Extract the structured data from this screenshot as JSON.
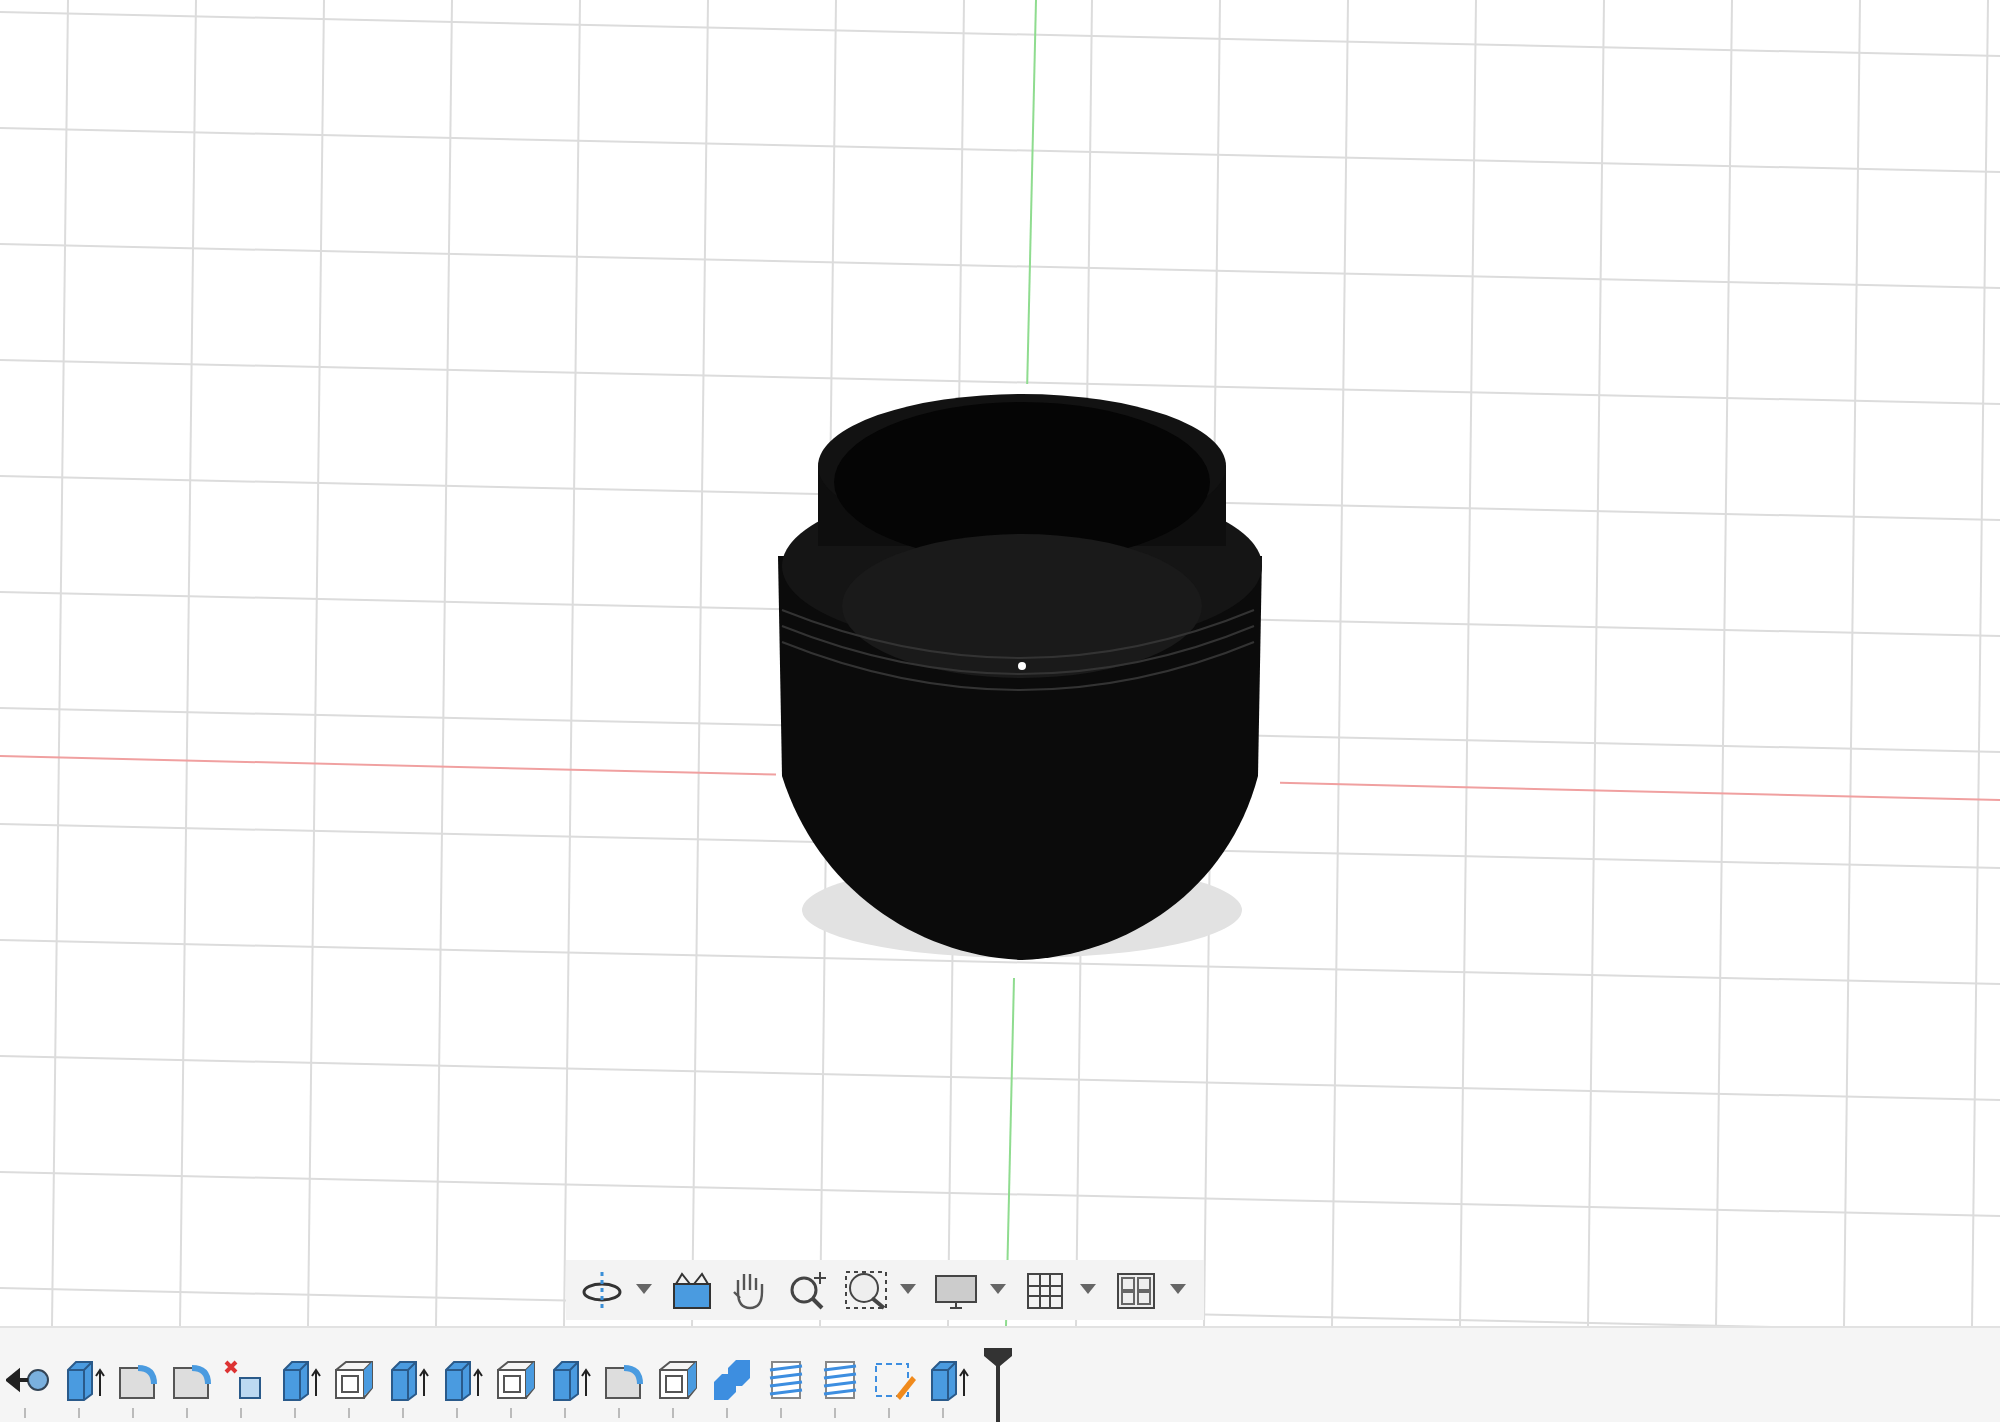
{
  "navigation_toolbar": [
    {
      "kind": "orbit",
      "dropdown": true
    },
    {
      "kind": "look-at",
      "dropdown": false
    },
    {
      "kind": "pan",
      "dropdown": false
    },
    {
      "kind": "zoom",
      "dropdown": false
    },
    {
      "kind": "fit",
      "dropdown": true
    },
    {
      "kind": "display",
      "dropdown": true
    },
    {
      "kind": "grid",
      "dropdown": true
    },
    {
      "kind": "viewports",
      "dropdown": true
    }
  ],
  "timeline": [
    {
      "kind": "rollback"
    },
    {
      "kind": "extrude"
    },
    {
      "kind": "fillet"
    },
    {
      "kind": "fillet"
    },
    {
      "kind": "delete"
    },
    {
      "kind": "extrude"
    },
    {
      "kind": "shell"
    },
    {
      "kind": "extrude"
    },
    {
      "kind": "extrude"
    },
    {
      "kind": "shell"
    },
    {
      "kind": "extrude"
    },
    {
      "kind": "fillet"
    },
    {
      "kind": "shell"
    },
    {
      "kind": "combine"
    },
    {
      "kind": "thread"
    },
    {
      "kind": "thread"
    },
    {
      "kind": "sketch"
    },
    {
      "kind": "extrude"
    },
    {
      "kind": "marker"
    }
  ]
}
